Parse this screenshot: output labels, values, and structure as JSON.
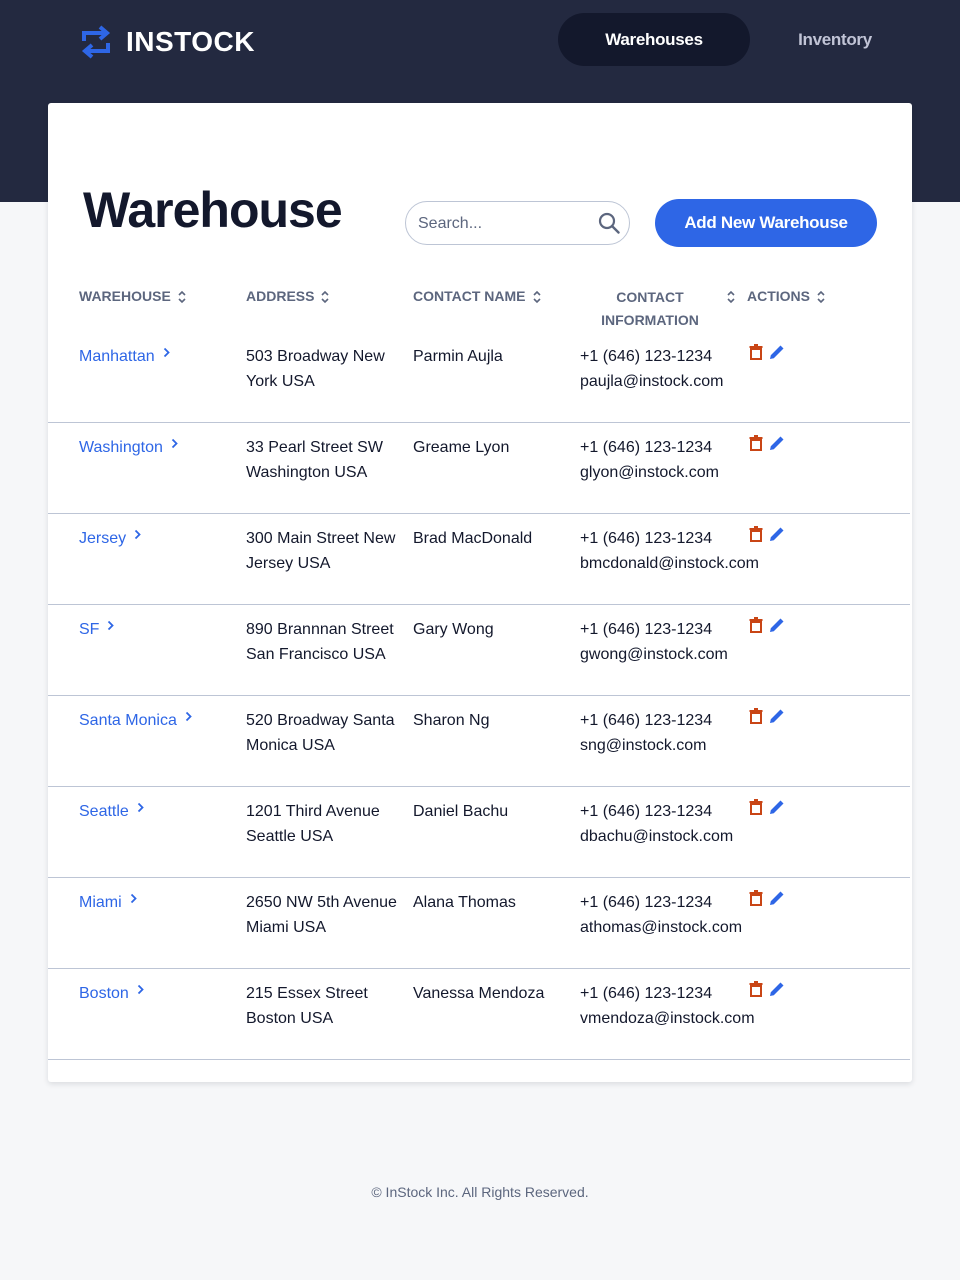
{
  "brand": {
    "name": "INSTOCK",
    "accent_color": "#2e66e6",
    "dark_color": "#232940"
  },
  "nav": {
    "warehouses_label": "Warehouses",
    "inventory_label": "Inventory",
    "active": "Warehouses"
  },
  "page": {
    "title": "Warehouse",
    "search_placeholder": "Search...",
    "add_button_label": "Add New Warehouse"
  },
  "table": {
    "headers": {
      "warehouse": "WAREHOUSE",
      "address": "ADDRESS",
      "contact_name": "CONTACT NAME",
      "contact_information_line1": "CONTACT",
      "contact_information_line2": "INFORMATION",
      "actions": "ACTIONS"
    },
    "rows": [
      {
        "name": "Manhattan",
        "address": "503 Broadway New York USA",
        "contact": "Parmin Aujla",
        "phone": "+1 (646) 123-1234",
        "email": "paujla@instock.com"
      },
      {
        "name": "Washington",
        "address": "33 Pearl Street SW Washington USA",
        "contact": "Greame Lyon",
        "phone": "+1 (646) 123-1234",
        "email": "glyon@instock.com"
      },
      {
        "name": "Jersey",
        "address": "300 Main Street New Jersey USA",
        "contact": "Brad MacDonald",
        "phone": "+1 (646) 123-1234",
        "email": "bmcdonald@instock.com"
      },
      {
        "name": "SF",
        "address": "890 Brannnan Street San Francisco USA",
        "contact": "Gary Wong",
        "phone": "+1 (646) 123-1234",
        "email": "gwong@instock.com"
      },
      {
        "name": "Santa Monica",
        "address": "520 Broadway Santa Monica USA",
        "contact": "Sharon Ng",
        "phone": "+1 (646) 123-1234",
        "email": "sng@instock.com"
      },
      {
        "name": "Seattle",
        "address": "1201 Third Avenue Seattle USA",
        "contact": "Daniel Bachu",
        "phone": "+1 (646) 123-1234",
        "email": "dbachu@instock.com"
      },
      {
        "name": "Miami",
        "address": "2650 NW 5th Avenue Miami USA",
        "contact": "Alana Thomas",
        "phone": "+1 (646) 123-1234",
        "email": "athomas@instock.com"
      },
      {
        "name": "Boston",
        "address": "215 Essex Street Boston USA",
        "contact": "Vanessa Mendoza",
        "phone": "+1 (646) 123-1234",
        "email": "vmendoza@instock.com"
      }
    ]
  },
  "icons": {
    "delete": "trash-icon",
    "edit": "pencil-icon",
    "chevron": "chevron-right-icon",
    "sort": "sort-icon",
    "search": "search-icon",
    "logo": "swap-arrows-icon",
    "delete_color": "#c94515",
    "edit_color": "#2e66e6"
  },
  "footer": {
    "text": "© InStock Inc. All Rights Reserved."
  }
}
